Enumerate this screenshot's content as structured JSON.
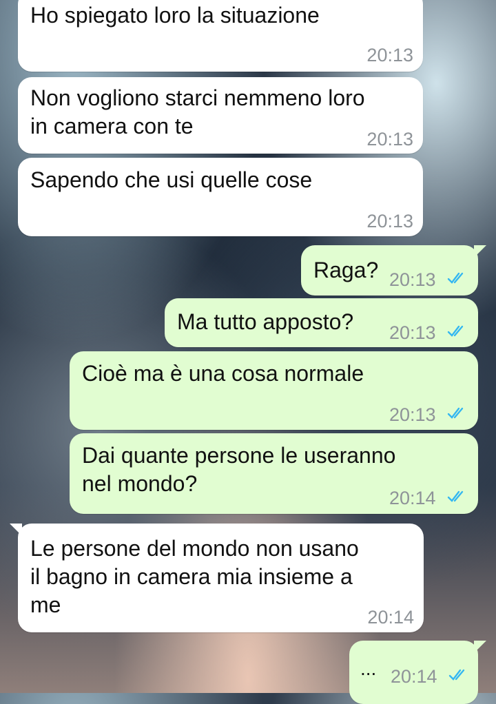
{
  "messages": [
    {
      "text_lines": [
        "Ho spiegato loro la situazione"
      ],
      "time": "20:13"
    },
    {
      "text_lines": [
        "Non vogliono starci nemmeno loro",
        "in camera con te"
      ],
      "time": "20:13"
    },
    {
      "text_lines": [
        "Sapendo che usi quelle cose"
      ],
      "time": "20:13"
    },
    {
      "text_lines": [
        "Raga?"
      ],
      "time": "20:13",
      "status": "read"
    },
    {
      "text_lines": [
        "Ma tutto apposto?"
      ],
      "time": "20:13",
      "status": "read"
    },
    {
      "text_lines": [
        "Cioè ma è una cosa normale"
      ],
      "time": "20:13",
      "status": "read"
    },
    {
      "text_lines": [
        "Dai quante persone le useranno",
        "nel mondo?"
      ],
      "time": "20:14",
      "status": "read"
    },
    {
      "text_lines": [
        "Le persone del mondo non usano",
        "il bagno in camera mia insieme a",
        "me"
      ],
      "time": "20:14"
    },
    {
      "text_lines": [
        "..."
      ],
      "time": "20:14",
      "status": "read"
    }
  ],
  "colors": {
    "incoming_bubble": "#ffffff",
    "outgoing_bubble": "#e1fdd1",
    "read_tick": "#34b7f1",
    "timestamp": "#8e9398"
  },
  "icons": {
    "read_status": "double-check-icon"
  }
}
